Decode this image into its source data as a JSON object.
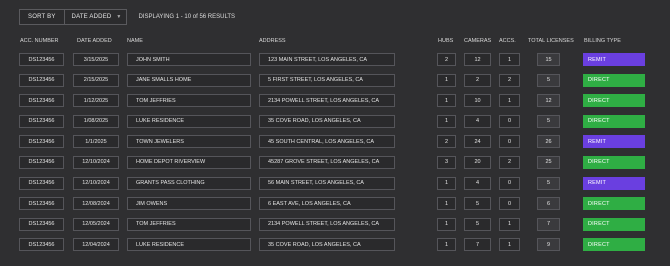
{
  "toolbar": {
    "sort_label": "SORT BY",
    "sort_value": "DATE ADDED",
    "results_text": "DISPLAYING 1 - 10 of 56 RESULTS"
  },
  "columns": {
    "acc_number": "ACC. NUMBER",
    "date_added": "DATE ADDED",
    "name": "NAME",
    "address": "ADDRESS",
    "hubs": "HUBS",
    "cameras": "CAMERAS",
    "accs": "ACCS.",
    "total_licenses": "TOTAL LICENSES",
    "billing_type": "BILLING TYPE"
  },
  "colors": {
    "remit": "#6a3fe0",
    "direct": "#2fae44"
  },
  "rows": [
    {
      "acc": "DS123456",
      "date": "3/15/2025",
      "name": "JOHN SMITH",
      "address": "123 MAIN STREET, LOS ANGELES, CA",
      "hubs": "2",
      "cameras": "12",
      "accs": "1",
      "licenses": "15",
      "billing": "REMIT"
    },
    {
      "acc": "DS123456",
      "date": "2/15/2025",
      "name": "JANE SMALLS HOME",
      "address": "5 FIRST STREET, LOS ANGELES, CA",
      "hubs": "1",
      "cameras": "2",
      "accs": "2",
      "licenses": "5",
      "billing": "DIRECT"
    },
    {
      "acc": "DS123456",
      "date": "1/12/2025",
      "name": "TOM JEFFRIES",
      "address": "2134 POWELL  STREET, LOS ANGELES, CA",
      "hubs": "1",
      "cameras": "10",
      "accs": "1",
      "licenses": "12",
      "billing": "DIRECT"
    },
    {
      "acc": "DS123456",
      "date": "1/08/2025",
      "name": "LUKE RESIDENCE",
      "address": "35 COVE ROAD, LOS ANGELES, CA",
      "hubs": "1",
      "cameras": "4",
      "accs": "0",
      "licenses": "5",
      "billing": "DIRECT"
    },
    {
      "acc": "DS123456",
      "date": "1/1/2025",
      "name": "TOWN JEWELERS",
      "address": "45 SOUTH CENTRAL, LOS ANGELES, CA",
      "hubs": "2",
      "cameras": "24",
      "accs": "0",
      "licenses": "26",
      "billing": "REMIT"
    },
    {
      "acc": "DS123456",
      "date": "12/10/2024",
      "name": "HOME DEPOT RIVERVIEW",
      "address": "45287 GROVE STREET, LOS ANGELES, CA",
      "hubs": "3",
      "cameras": "20",
      "accs": "2",
      "licenses": "25",
      "billing": "DIRECT"
    },
    {
      "acc": "DS123456",
      "date": "12/10/2024",
      "name": "GRANTS PASS CLOTHING",
      "address": "56 MAIN STREET, LOS ANGELES, CA",
      "hubs": "1",
      "cameras": "4",
      "accs": "0",
      "licenses": "5",
      "billing": "REMIT"
    },
    {
      "acc": "DS123456",
      "date": "12/08/2024",
      "name": "JIM OWENS",
      "address": "6 EAST AVE, LOS ANGELES, CA",
      "hubs": "1",
      "cameras": "5",
      "accs": "0",
      "licenses": "6",
      "billing": "DIRECT"
    },
    {
      "acc": "DS123456",
      "date": "12/05/2024",
      "name": "TOM JEFFRIES",
      "address": "2134 POWELL  STREET, LOS ANGELES, CA",
      "hubs": "1",
      "cameras": "5",
      "accs": "1",
      "licenses": "7",
      "billing": "DIRECT"
    },
    {
      "acc": "DS123456",
      "date": "12/04/2024",
      "name": "LUKE RESIDENCE",
      "address": "35 COVE ROAD, LOS ANGELES, CA",
      "hubs": "1",
      "cameras": "7",
      "accs": "1",
      "licenses": "9",
      "billing": "DIRECT"
    }
  ]
}
